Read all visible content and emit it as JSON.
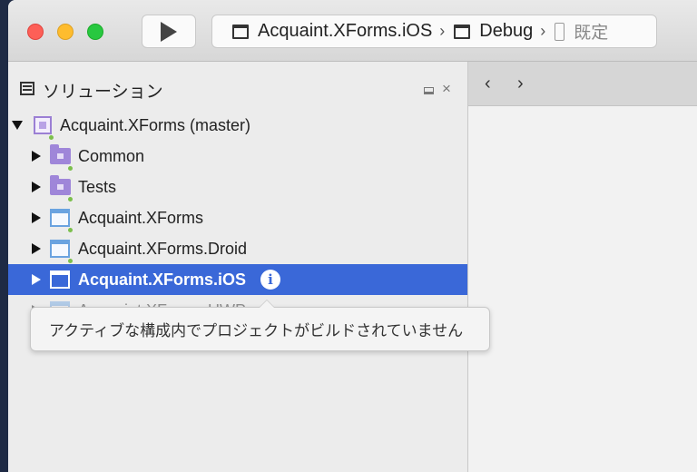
{
  "toolbar": {
    "project": "Acquaint.XForms.iOS",
    "configuration": "Debug",
    "device": "既定",
    "separator": "›"
  },
  "solution_pad": {
    "title": "ソリューション",
    "close_glyph": "×"
  },
  "tree": [
    {
      "label": "Acquaint.XForms (master)",
      "type": "solution",
      "expanded": true
    },
    {
      "label": "Common",
      "type": "folder",
      "expanded": false
    },
    {
      "label": "Tests",
      "type": "folder",
      "expanded": false
    },
    {
      "label": "Acquaint.XForms",
      "type": "project",
      "expanded": false
    },
    {
      "label": "Acquaint.XForms.Droid",
      "type": "project",
      "expanded": false
    },
    {
      "label": "Acquaint.XForms.iOS",
      "type": "project",
      "expanded": false,
      "selected": true
    },
    {
      "label": "Acquaint.XForms.UWP",
      "type": "project",
      "expanded": false,
      "disabled": true
    }
  ],
  "tooltip": {
    "text": "アクティブな構成内でプロジェクトがビルドされていません"
  },
  "editor": {
    "back_glyph": "‹",
    "forward_glyph": "›"
  },
  "info_glyph": "i",
  "colors": {
    "selection": "#3a68d8",
    "close": "#fd5f57",
    "minimize": "#febc2e",
    "maximize": "#28c840"
  }
}
